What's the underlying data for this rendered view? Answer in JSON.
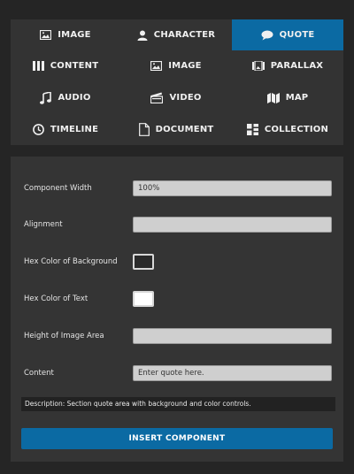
{
  "tabs": [
    {
      "label": "IMAGE",
      "icon": "image-icon",
      "active": false
    },
    {
      "label": "CHARACTER",
      "icon": "user-icon",
      "active": false
    },
    {
      "label": "QUOTE",
      "icon": "speech-bubble-icon",
      "active": true
    },
    {
      "label": "CONTENT",
      "icon": "columns-icon",
      "active": false
    },
    {
      "label": "IMAGE",
      "icon": "image-icon",
      "active": false
    },
    {
      "label": "PARALLAX",
      "icon": "parallax-icon",
      "active": false
    },
    {
      "label": "AUDIO",
      "icon": "music-note-icon",
      "active": false
    },
    {
      "label": "VIDEO",
      "icon": "clapperboard-icon",
      "active": false
    },
    {
      "label": "MAP",
      "icon": "map-icon",
      "active": false
    },
    {
      "label": "TIMELINE",
      "icon": "clock-icon",
      "active": false
    },
    {
      "label": "DOCUMENT",
      "icon": "document-icon",
      "active": false
    },
    {
      "label": "COLLECTION",
      "icon": "grid-icon",
      "active": false
    }
  ],
  "form": {
    "component_width": {
      "label": "Component Width",
      "value": "100%"
    },
    "alignment": {
      "label": "Alignment",
      "value": ""
    },
    "bg_color": {
      "label": "Hex Color of Background",
      "value": "#2a2a2a"
    },
    "text_color": {
      "label": "Hex Color of Text",
      "value": "#ffffff"
    },
    "image_height": {
      "label": "Height of Image Area",
      "value": ""
    },
    "content": {
      "label": "Content",
      "value": "Enter quote here."
    }
  },
  "description": "Description: Section quote area with background and color controls.",
  "insert_button": "INSERT COMPONENT",
  "colors": {
    "accent": "#0b6aa3",
    "panel": "#333333",
    "background": "#252525"
  }
}
